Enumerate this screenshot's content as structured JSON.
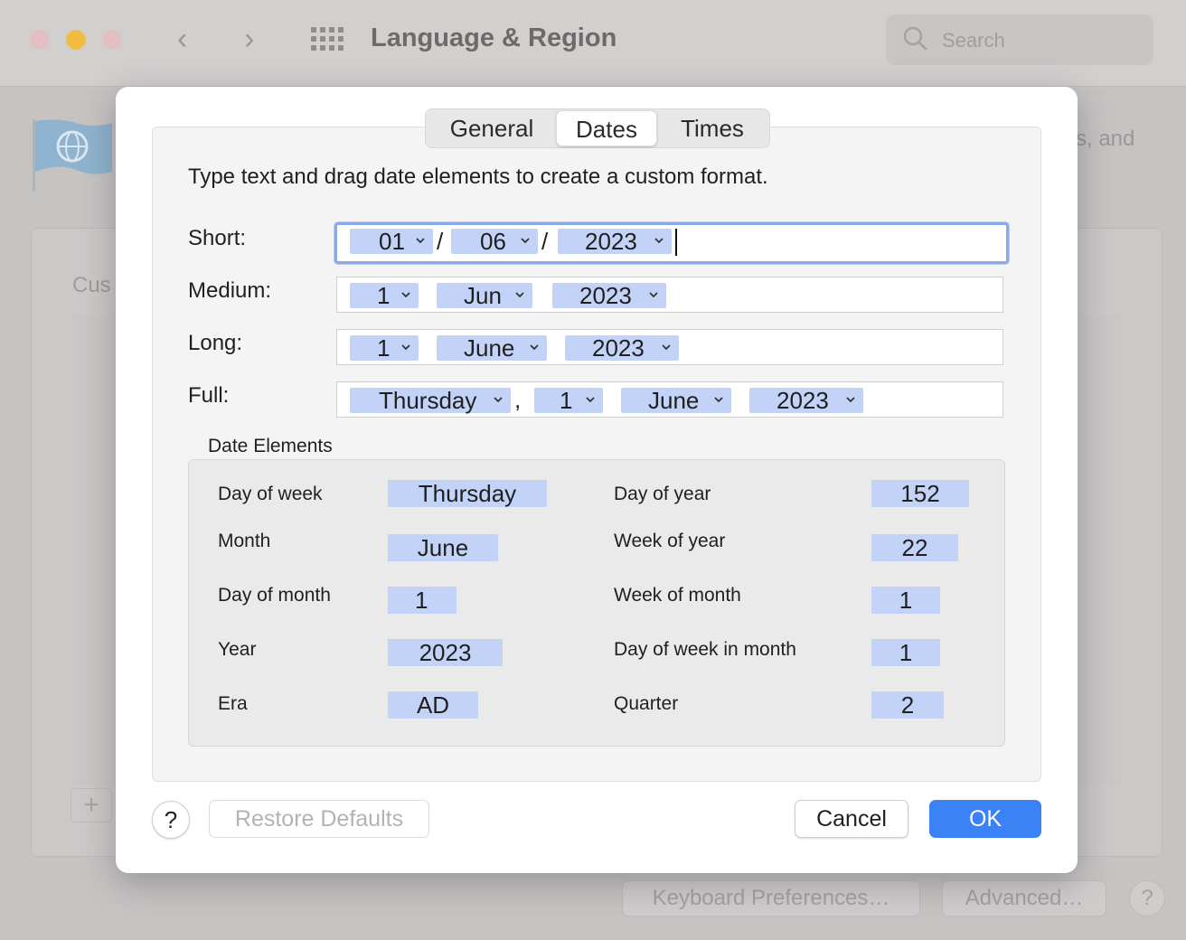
{
  "window": {
    "title": "Language & Region",
    "search_placeholder": "Search",
    "bg_desc_fragment": "s, and",
    "bg_list_fragment": "Cus",
    "bg_add": "+",
    "keyboard_prefs": "Keyboard Preferences…",
    "advanced": "Advanced…",
    "help": "?"
  },
  "dialog": {
    "tabs": [
      "General",
      "Dates",
      "Times"
    ],
    "active_tab": "Dates",
    "instructions": "Type text and drag date elements to create a custom format.",
    "formats": {
      "short": {
        "label": "Short:",
        "tokens": [
          "01",
          "06",
          "2023"
        ],
        "separators": [
          "/",
          "/"
        ]
      },
      "medium": {
        "label": "Medium:",
        "tokens": [
          "1",
          "Jun",
          "2023"
        ]
      },
      "long": {
        "label": "Long:",
        "tokens": [
          "1",
          "June",
          "2023"
        ]
      },
      "full": {
        "label": "Full:",
        "tokens": [
          "Thursday",
          "1",
          "June",
          "2023"
        ],
        "separators": [
          ","
        ]
      }
    },
    "elements_title": "Date Elements",
    "elements": {
      "day_of_week": {
        "label": "Day of week",
        "value": "Thursday"
      },
      "month": {
        "label": "Month",
        "value": "June"
      },
      "day_of_month": {
        "label": "Day of month",
        "value": "1"
      },
      "year": {
        "label": "Year",
        "value": "2023"
      },
      "era": {
        "label": "Era",
        "value": "AD"
      },
      "day_of_year": {
        "label": "Day of year",
        "value": "152"
      },
      "week_of_year": {
        "label": "Week of year",
        "value": "22"
      },
      "week_of_month": {
        "label": "Week of month",
        "value": "1"
      },
      "day_of_week_in_month": {
        "label": "Day of week in month",
        "value": "1"
      },
      "quarter": {
        "label": "Quarter",
        "value": "2"
      }
    },
    "buttons": {
      "help": "?",
      "restore": "Restore Defaults",
      "cancel": "Cancel",
      "ok": "OK"
    }
  },
  "colors": {
    "token_bg": "#c3d3f7",
    "accent": "#3b82f6",
    "focus_ring": "#8aa9e8"
  }
}
